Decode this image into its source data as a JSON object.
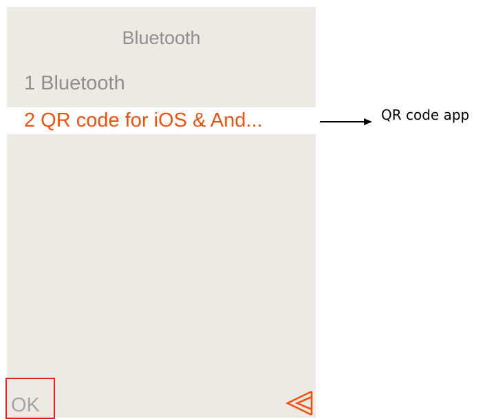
{
  "screen": {
    "title": "Bluetooth",
    "menu": [
      {
        "label": "1 Bluetooth",
        "selected": false
      },
      {
        "label": "2 QR code for iOS & And...",
        "selected": true
      }
    ],
    "softkeys": {
      "left_label": "OK",
      "right_icon": "back-double-chevron-icon"
    }
  },
  "annotation": {
    "label": "QR code app",
    "arrow_icon": "right-arrow-icon"
  },
  "colors": {
    "screen_background": "#edeae4",
    "highlight_background": "#ffffff",
    "accent": "#f2500d",
    "muted_text": "#8e8e8e",
    "annotation_box": "#e8201c"
  }
}
